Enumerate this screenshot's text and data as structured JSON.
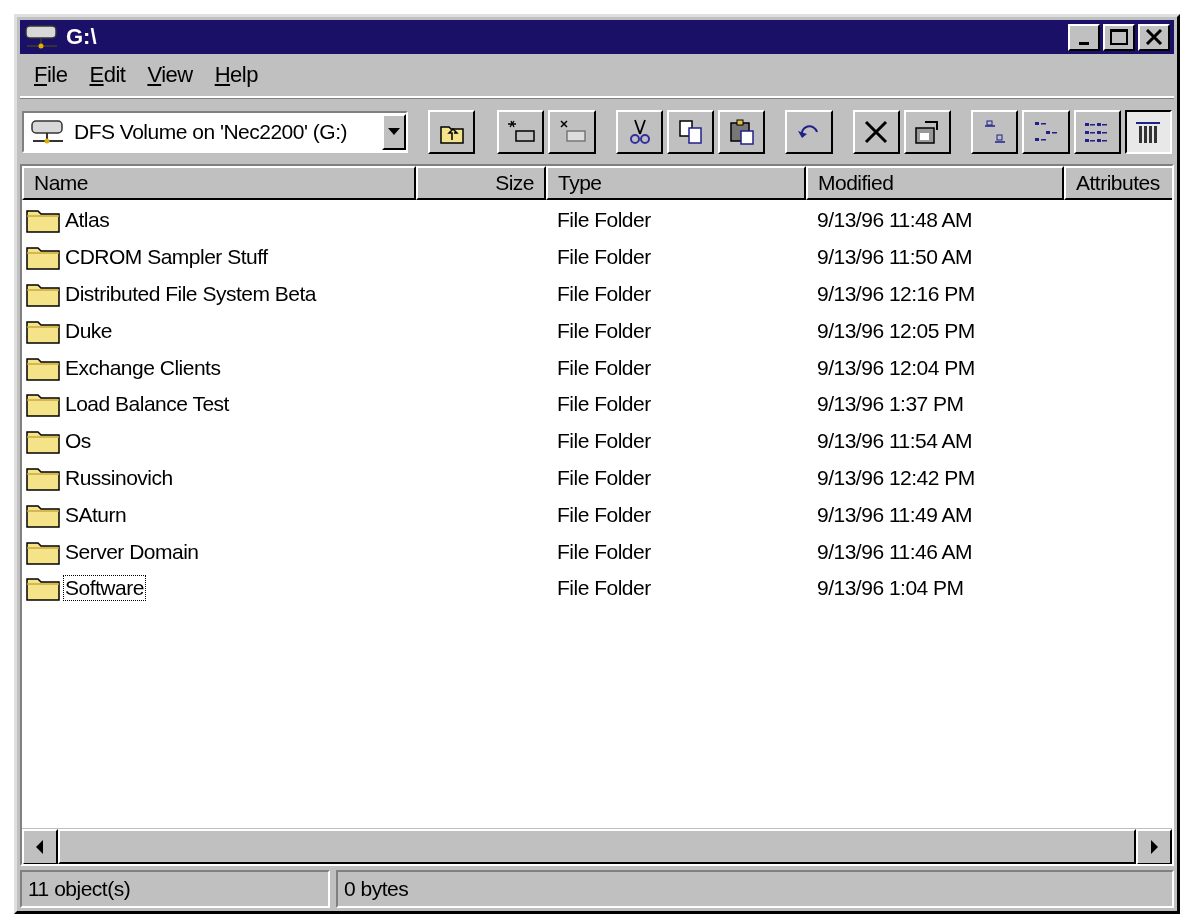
{
  "window": {
    "title": "G:\\"
  },
  "menu": [
    "File",
    "Edit",
    "View",
    "Help"
  ],
  "address": {
    "value": "DFS Volume on 'Nec2200' (G:)"
  },
  "toolbar": [
    {
      "kind": "up",
      "selected": false
    },
    {
      "kind": "map",
      "selected": false
    },
    {
      "kind": "disconnect",
      "selected": false
    },
    {
      "kind": "cut",
      "selected": false
    },
    {
      "kind": "copy",
      "selected": false
    },
    {
      "kind": "paste",
      "selected": false
    },
    {
      "kind": "undo",
      "selected": false
    },
    {
      "kind": "delete",
      "selected": false
    },
    {
      "kind": "properties",
      "selected": false
    },
    {
      "kind": "large",
      "selected": false
    },
    {
      "kind": "small",
      "selected": false
    },
    {
      "kind": "list",
      "selected": false
    },
    {
      "kind": "details",
      "selected": true
    }
  ],
  "table": {
    "columns": [
      "Name",
      "Size",
      "Type",
      "Modified",
      "Attributes"
    ],
    "rows": [
      {
        "name": "Atlas",
        "type": "File Folder",
        "modified": "9/13/96 11:48 AM",
        "focused": false
      },
      {
        "name": "CDROM Sampler Stuff",
        "type": "File Folder",
        "modified": "9/13/96 11:50 AM",
        "focused": false
      },
      {
        "name": "Distributed File System Beta",
        "type": "File Folder",
        "modified": "9/13/96 12:16 PM",
        "focused": false
      },
      {
        "name": "Duke",
        "type": "File Folder",
        "modified": "9/13/96 12:05 PM",
        "focused": false
      },
      {
        "name": "Exchange Clients",
        "type": "File Folder",
        "modified": "9/13/96 12:04 PM",
        "focused": false
      },
      {
        "name": "Load Balance Test",
        "type": "File Folder",
        "modified": "9/13/96 1:37 PM",
        "focused": false
      },
      {
        "name": "Os",
        "type": "File Folder",
        "modified": "9/13/96 11:54 AM",
        "focused": false
      },
      {
        "name": "Russinovich",
        "type": "File Folder",
        "modified": "9/13/96 12:42 PM",
        "focused": false
      },
      {
        "name": "SAturn",
        "type": "File Folder",
        "modified": "9/13/96 11:49 AM",
        "focused": false
      },
      {
        "name": "Server Domain",
        "type": "File Folder",
        "modified": "9/13/96 11:46 AM",
        "focused": false
      },
      {
        "name": "Software",
        "type": "File Folder",
        "modified": "9/13/96 1:04 PM",
        "focused": true
      }
    ]
  },
  "status_bar": [
    "11 object(s)",
    "0 bytes"
  ]
}
